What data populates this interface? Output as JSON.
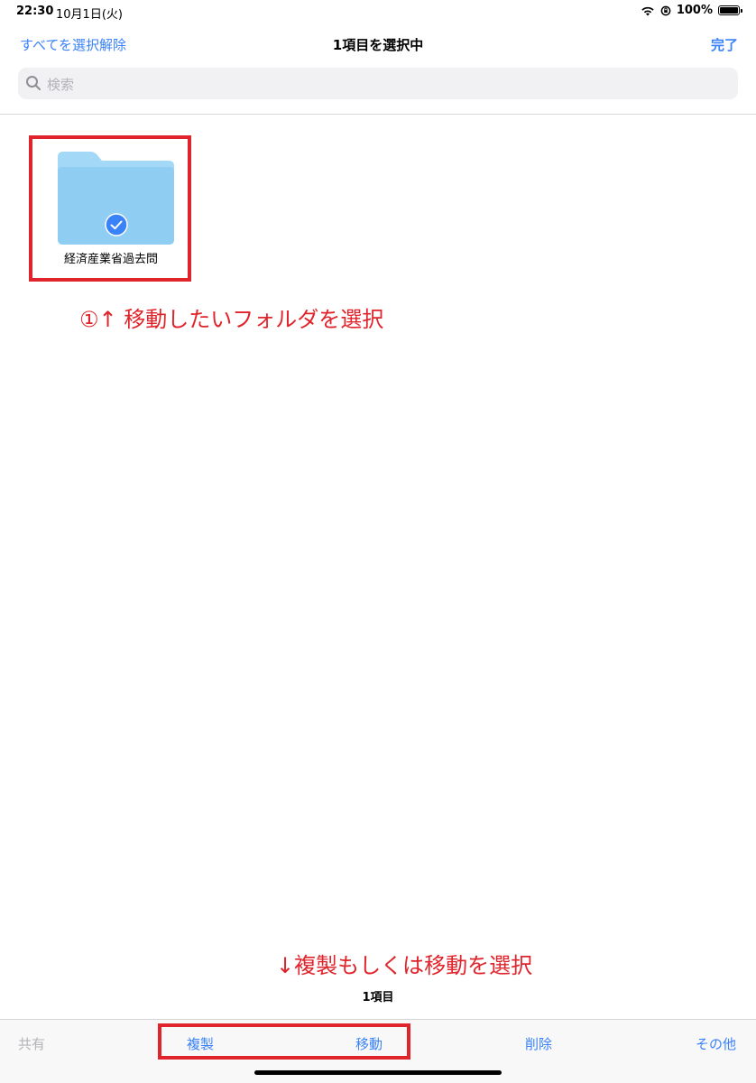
{
  "status_bar": {
    "time": "22:30",
    "date": "10月1日(火)",
    "battery": "100%",
    "icons": [
      "wifi-icon",
      "orientation-lock-icon",
      "battery-icon"
    ]
  },
  "nav": {
    "deselect_all": "すべてを選択解除",
    "title": "1項目を選択中",
    "done": "完了"
  },
  "search": {
    "placeholder": "検索"
  },
  "files": [
    {
      "name": "経済産業省過去問",
      "type": "folder",
      "selected": true
    }
  ],
  "annotations": {
    "select_folder": "①↑ 移動したいフォルダを選択",
    "choose_action": "↓複製もしくは移動を選択"
  },
  "footer": {
    "item_count": "1項目"
  },
  "toolbar": {
    "share": "共有",
    "duplicate": "複製",
    "move": "移動",
    "delete": "削除",
    "more": "その他"
  },
  "colors": {
    "accent": "#3a82f7",
    "annotation": "#e0242b",
    "folder": "#8fcdf3"
  }
}
